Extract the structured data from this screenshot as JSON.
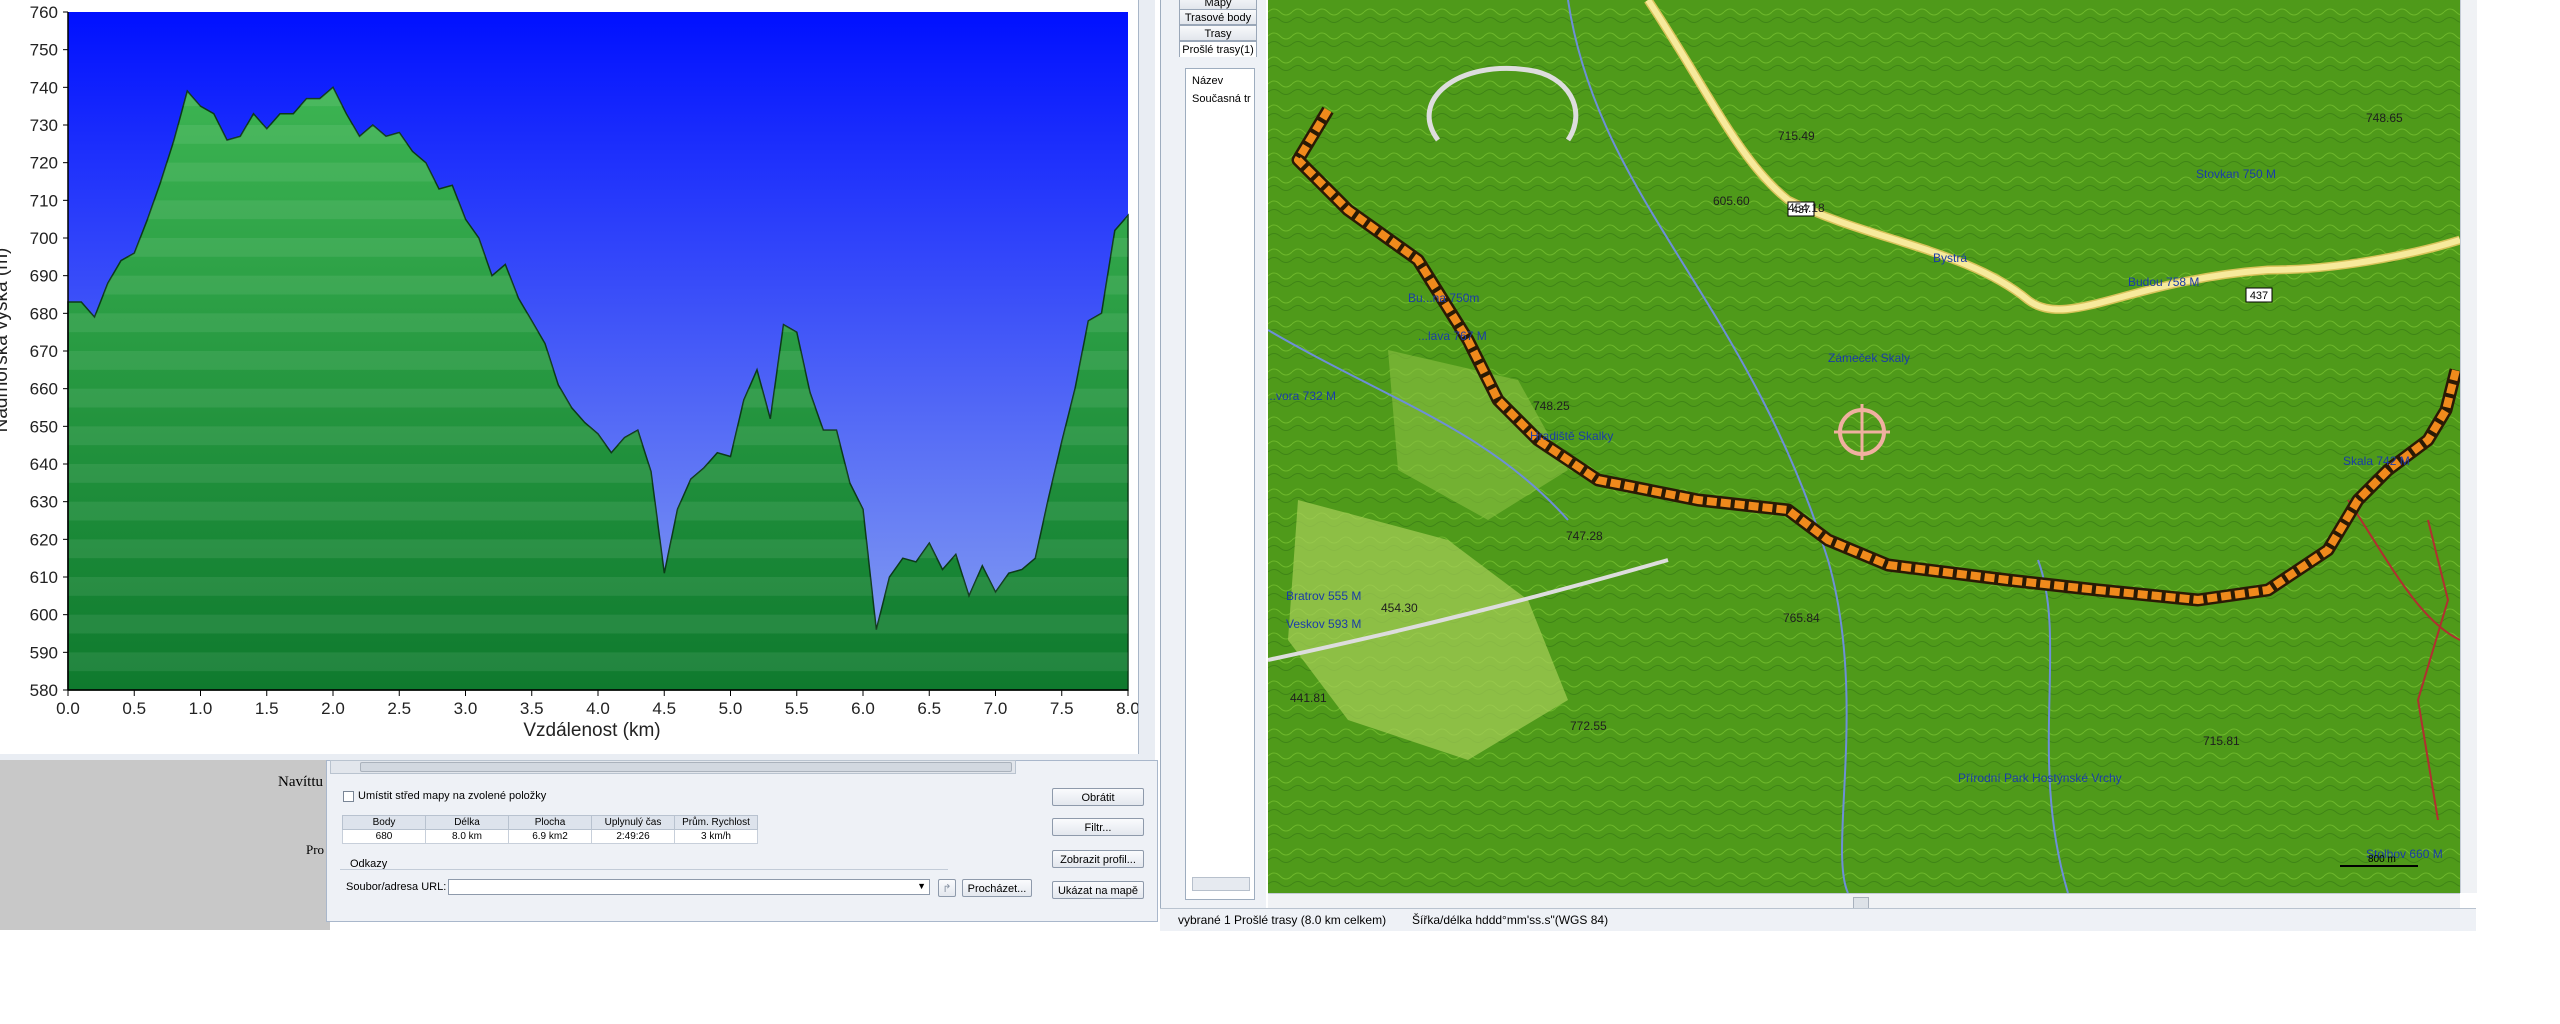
{
  "profile": {
    "y_axis_title": "Nadmořská výška (m)",
    "x_axis_title": "Vzdálenost  (km)"
  },
  "chart_data": {
    "type": "area",
    "xlabel": "Vzdálenost  (km)",
    "ylabel": "Nadmořská výška (m)",
    "xlim": [
      0.0,
      8.0
    ],
    "ylim": [
      580,
      760
    ],
    "x_ticks": [
      "0.0",
      "0.5",
      "1.0",
      "1.5",
      "2.0",
      "2.5",
      "3.0",
      "3.5",
      "4.0",
      "4.5",
      "5.0",
      "5.5",
      "6.0",
      "6.5",
      "7.0",
      "7.5",
      "8.0"
    ],
    "y_ticks": [
      "580",
      "590",
      "600",
      "610",
      "620",
      "630",
      "640",
      "650",
      "660",
      "670",
      "680",
      "690",
      "700",
      "710",
      "720",
      "730",
      "740",
      "750",
      "760"
    ],
    "x": [
      0.0,
      0.1,
      0.2,
      0.3,
      0.4,
      0.5,
      0.6,
      0.7,
      0.8,
      0.9,
      1.0,
      1.1,
      1.2,
      1.3,
      1.4,
      1.5,
      1.6,
      1.7,
      1.8,
      1.9,
      2.0,
      2.1,
      2.2,
      2.3,
      2.4,
      2.5,
      2.6,
      2.7,
      2.8,
      2.9,
      3.0,
      3.1,
      3.2,
      3.3,
      3.4,
      3.5,
      3.6,
      3.7,
      3.8,
      3.9,
      4.0,
      4.1,
      4.2,
      4.3,
      4.4,
      4.5,
      4.6,
      4.7,
      4.8,
      4.9,
      5.0,
      5.1,
      5.2,
      5.3,
      5.4,
      5.5,
      5.6,
      5.7,
      5.8,
      5.9,
      6.0,
      6.1,
      6.2,
      6.3,
      6.4,
      6.5,
      6.6,
      6.7,
      6.8,
      6.9,
      7.0,
      7.1,
      7.2,
      7.3,
      7.4,
      7.5,
      7.6,
      7.7,
      7.8,
      7.9,
      8.0
    ],
    "y": [
      683,
      683,
      679,
      688,
      694,
      696,
      705,
      715,
      726,
      739,
      735,
      733,
      726,
      727,
      733,
      729,
      733,
      733,
      737,
      737,
      740,
      733,
      727,
      730,
      727,
      728,
      723,
      720,
      713,
      714,
      705,
      700,
      690,
      693,
      684,
      678,
      672,
      661,
      655,
      651,
      648,
      643,
      647,
      649,
      638,
      611,
      628,
      636,
      639,
      643,
      642,
      657,
      665,
      652,
      677,
      675,
      659,
      649,
      649,
      635,
      628,
      596,
      610,
      615,
      614,
      619,
      612,
      616,
      605,
      613,
      606,
      611,
      612,
      615,
      631,
      646,
      660,
      678,
      680,
      702,
      706
    ],
    "fill_colors": {
      "sky_top": "#0010ff",
      "sky_bottom": "#8ca6f0",
      "ground_top": "#2ea04a",
      "ground_bottom": "#0f6e2a"
    }
  },
  "left_panel": {
    "label_nav": "Navíttu",
    "label_pro": "Pro"
  },
  "dialog": {
    "center_map_label": "Umístit střed mapy na zvolené položky",
    "stats_headers": [
      "Body",
      "Délka",
      "Plocha",
      "Uplynulý čas",
      "Prům. Rychlost"
    ],
    "stats_values": [
      "680",
      "8.0 km",
      "6.9 km2",
      "2:49:26",
      "3 km/h"
    ],
    "links_label": "Odkazy",
    "url_label": "Soubor/adresa URL:",
    "url_value": "",
    "browse_button": "Procházet...",
    "reverse_button": "Obrátit",
    "filter_button": "Filtr...",
    "profile_button": "Zobrazit profil...",
    "show_on_map_button": "Ukázat na mapě"
  },
  "sidebar": {
    "tabs": [
      "Mapy",
      "Trasové body",
      "Trasy",
      "Prošlé trasy(1)"
    ],
    "list_header": "Název",
    "list_item": "Současná tr"
  },
  "map": {
    "roads": [
      "437",
      "437"
    ],
    "labels": [
      {
        "text": "715.49"
      },
      {
        "text": "748.65"
      },
      {
        "text": "Stovkan 750 M"
      },
      {
        "text": "Budou 758 M"
      },
      {
        "text": "454.18"
      },
      {
        "text": "Bystrá"
      },
      {
        "text": "Bu...na 750m"
      },
      {
        "text": "...vora 732 M"
      },
      {
        "text": "Hradiště Skalky"
      },
      {
        "text": "748.25"
      },
      {
        "text": "Zámeček Skaly"
      },
      {
        "text": "...lava 767 M"
      },
      {
        "text": "Skala 742 M"
      },
      {
        "text": "Bratrov 555 M"
      },
      {
        "text": "454.30"
      },
      {
        "text": "765.84"
      },
      {
        "text": "Přírodní Park Hostýnské Vrchy"
      },
      {
        "text": "Stolbov 660 M"
      },
      {
        "text": "441.81"
      },
      {
        "text": "Veskov 593 M"
      },
      {
        "text": "715.81"
      },
      {
        "text": "772.55"
      },
      {
        "text": "747.28"
      },
      {
        "text": "605.60"
      }
    ],
    "scale_label": "800 m",
    "colors": {
      "track": "#f08a1c",
      "terrain": "#4f9a1a",
      "road": "#f5e79a"
    }
  },
  "status_bar": {
    "selection": "vybrané 1 Prošlé trasy (8.0 km celkem)",
    "coord_format": "Šířka/délka hddd°mm'ss.s\"(WGS 84)"
  }
}
